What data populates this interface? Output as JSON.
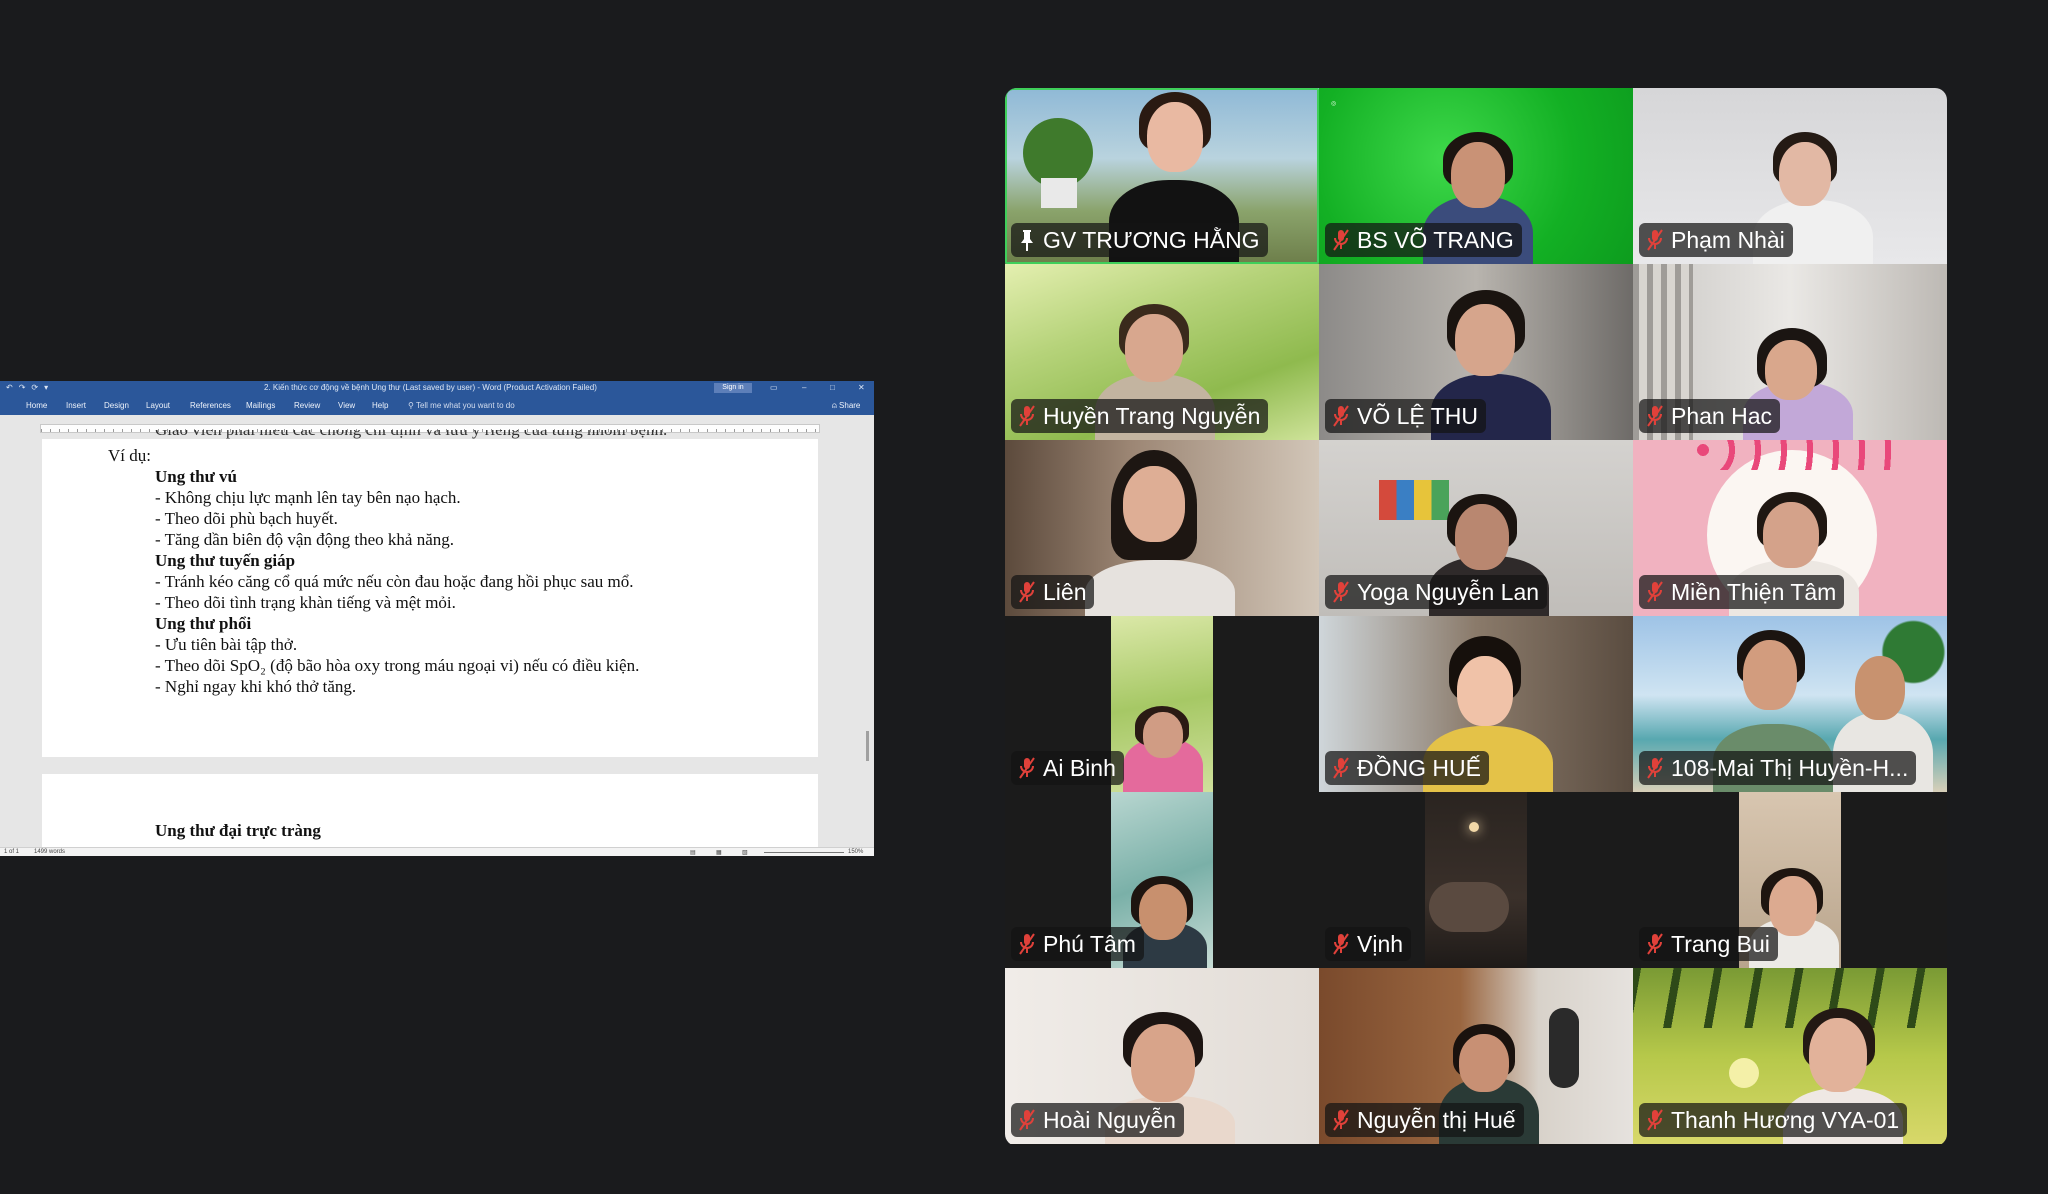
{
  "word": {
    "title": "2. Kiến thức cơ động về bệnh Ung thư (Last saved by user) - Word (Product Activation Failed)",
    "sign_in": "Sign in",
    "tabs": [
      "Home",
      "Insert",
      "Design",
      "Layout",
      "References",
      "Mailings",
      "Review",
      "View",
      "Help"
    ],
    "tell_me": "Tell me what you want to do",
    "share": "Share",
    "cut_line": "Giáo viên phải hiểu các chống chỉ định và lưu ý riêng của từng nhóm bệnh.",
    "example_label": "Ví dụ:",
    "sections": [
      {
        "heading": "Ung thư vú",
        "items": [
          "- Không chịu lực mạnh lên tay bên nạo hạch.",
          "- Theo dõi phù bạch huyết.",
          "- Tăng dần biên độ vận động theo khả năng."
        ]
      },
      {
        "heading": "Ung thư tuyến giáp",
        "items": [
          "- Tránh kéo căng cổ quá mức nếu còn đau hoặc đang hồi phục sau mổ.",
          "- Theo dõi tình trạng khàn tiếng và mệt mỏi."
        ]
      },
      {
        "heading": "Ung thư phổi",
        "items": [
          "- Ưu tiên bài tập thở.",
          "- Theo dõi SpO₂ (độ bão hòa oxy trong máu ngoại vi) nếu có điều kiện.",
          "- Nghỉ ngay khi khó thở tăng."
        ]
      }
    ],
    "page2_heading": "Ung thư đại trực tràng",
    "status_page": "1 of 1",
    "status_words": "1499 words",
    "zoom": "150%"
  },
  "participants": [
    {
      "name": "GV TRƯƠNG HẰNG",
      "icon": "pin-icon",
      "active": true
    },
    {
      "name": "BS VÕ TRANG",
      "icon": "mic-muted-icon"
    },
    {
      "name": "Phạm Nhài",
      "icon": "mic-muted-icon"
    },
    {
      "name": "Huyền Trang Nguyễn",
      "icon": "mic-muted-icon"
    },
    {
      "name": "VÕ LỆ THU",
      "icon": "mic-muted-icon"
    },
    {
      "name": "Phan Hac",
      "icon": "mic-muted-icon"
    },
    {
      "name": "Liên",
      "icon": "mic-muted-icon"
    },
    {
      "name": "Yoga Nguyễn Lan",
      "icon": "mic-muted-icon"
    },
    {
      "name": "Miền Thiện Tâm",
      "icon": "mic-muted-icon"
    },
    {
      "name": "Ai Binh",
      "icon": "mic-muted-icon"
    },
    {
      "name": "ĐỒNG HUẾ",
      "icon": "mic-muted-icon"
    },
    {
      "name": "108-Mai Thị Huyền-H...",
      "icon": "mic-muted-icon"
    },
    {
      "name": "Phú Tâm",
      "icon": "mic-muted-icon"
    },
    {
      "name": "Vịnh",
      "icon": "mic-muted-icon"
    },
    {
      "name": "Trang Bui",
      "icon": "mic-muted-icon"
    },
    {
      "name": "Hoài Nguyễn",
      "icon": "mic-muted-icon"
    },
    {
      "name": "Nguyễn thị Huế",
      "icon": "mic-muted-icon"
    },
    {
      "name": "Thanh Hương VYA-01",
      "icon": "mic-muted-icon"
    }
  ],
  "colors": {
    "active_speaker": "#3fcf5a",
    "mute_red": "#e0413a",
    "word_blue": "#2b579a"
  }
}
